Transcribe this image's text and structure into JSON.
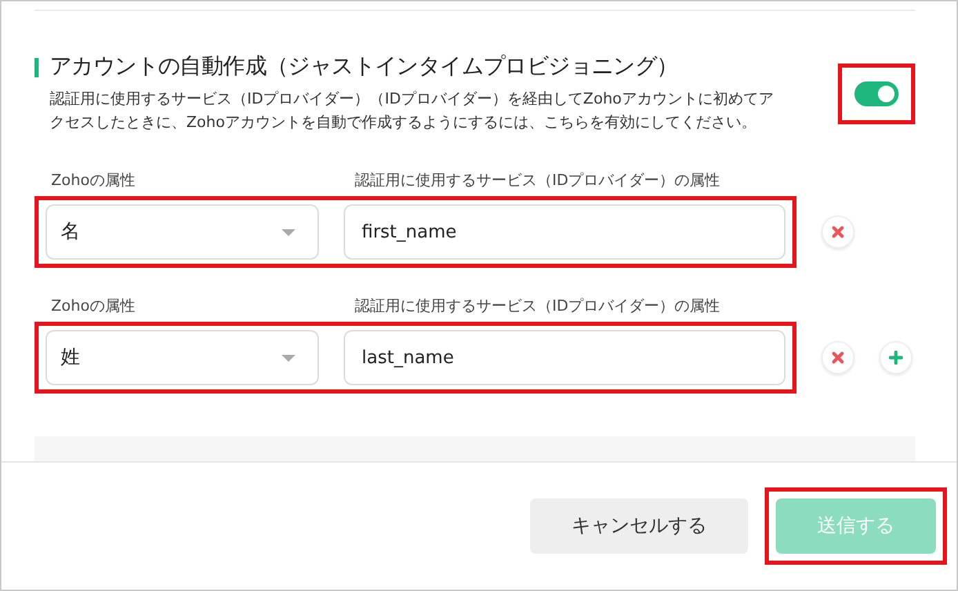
{
  "section": {
    "title": "アカウントの自動作成（ジャストインタイムプロビジョニング）",
    "description": "認証用に使用するサービス（IDプロバイダー）（IDプロバイダー）を経由してZohoアカウントに初めてアクセスしたときに、Zohoアカウントを自動で作成するようにするには、こちらを有効にしてください。",
    "toggle": {
      "on": true,
      "highlighted": true
    }
  },
  "mappings": [
    {
      "zoho_label": "Zohoの属性",
      "zoho_value": "名",
      "idp_label": "認証用に使用するサービス（IDプロバイダー）の属性",
      "idp_value": "first_name",
      "highlighted": true,
      "actions": [
        {
          "kind": "remove"
        }
      ]
    },
    {
      "zoho_label": "Zohoの属性",
      "zoho_value": "姓",
      "idp_label": "認証用に使用するサービス（IDプロバイダー）の属性",
      "idp_value": "last_name",
      "highlighted": true,
      "actions": [
        {
          "kind": "remove"
        },
        {
          "kind": "add"
        }
      ]
    }
  ],
  "buttons": [
    {
      "label": "キャンセルする",
      "kind": "secondary",
      "disabled": false,
      "highlighted": false
    },
    {
      "label": "送信する",
      "kind": "primary",
      "disabled": true,
      "highlighted": true
    }
  ]
}
